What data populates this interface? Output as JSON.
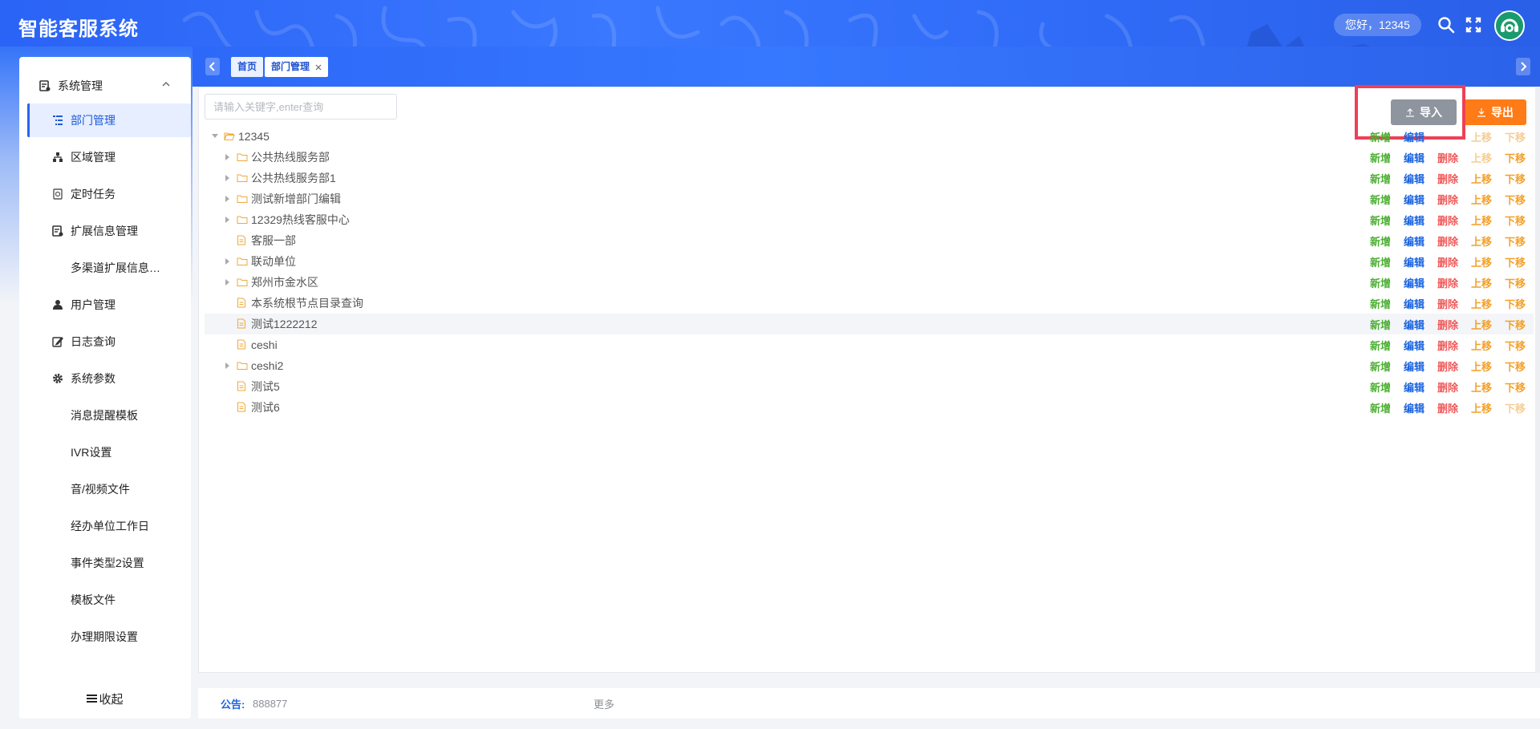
{
  "header": {
    "app_title": "智能客服系统",
    "greeting": "您好，12345",
    "icons": [
      "search-icon",
      "fullscreen-icon",
      "avatar-headset-icon"
    ]
  },
  "sidebar": {
    "group_label": "系统管理",
    "items": [
      {
        "label": "部门管理",
        "icon": "tree-list-icon",
        "active": true
      },
      {
        "label": "区域管理",
        "icon": "org-chart-icon"
      },
      {
        "label": "定时任务",
        "icon": "timer-icon"
      },
      {
        "label": "扩展信息管理",
        "icon": "document-icon"
      },
      {
        "label": "多渠道扩展信息…",
        "icon": ""
      },
      {
        "label": "用户管理",
        "icon": "user-icon"
      },
      {
        "label": "日志查询",
        "icon": "edit-log-icon"
      },
      {
        "label": "系统参数",
        "icon": "gear-icon"
      },
      {
        "label": "消息提醒模板",
        "icon": ""
      },
      {
        "label": "IVR设置",
        "icon": ""
      },
      {
        "label": "音/视频文件",
        "icon": ""
      },
      {
        "label": "经办单位工作日",
        "icon": ""
      },
      {
        "label": "事件类型2设置",
        "icon": ""
      },
      {
        "label": "模板文件",
        "icon": ""
      },
      {
        "label": "办理期限设置",
        "icon": ""
      }
    ],
    "collapse_label": "收起"
  },
  "tabs": {
    "home": "首页",
    "active": "部门管理"
  },
  "toolbar": {
    "search_placeholder": "请输入关键字,enter查询",
    "import_label": "导入",
    "export_label": "导出"
  },
  "ops_labels": {
    "add": "新增",
    "edit": "编辑",
    "delete": "删除",
    "up": "上移",
    "down": "下移"
  },
  "tree": [
    {
      "label": "12345",
      "level": 0,
      "type": "folder-open",
      "expandable": true,
      "ops": [
        "add",
        "edit",
        "up-disabled",
        "down-disabled"
      ]
    },
    {
      "label": "公共热线服务部",
      "level": 1,
      "type": "folder",
      "expandable": true,
      "ops": [
        "add",
        "edit",
        "delete",
        "up-disabled",
        "down"
      ]
    },
    {
      "label": "公共热线服务部1",
      "level": 1,
      "type": "folder",
      "expandable": true,
      "ops": [
        "add",
        "edit",
        "delete",
        "up",
        "down"
      ]
    },
    {
      "label": "测试新增部门编辑",
      "level": 1,
      "type": "folder",
      "expandable": true,
      "ops": [
        "add",
        "edit",
        "delete",
        "up",
        "down"
      ]
    },
    {
      "label": "12329热线客服中心",
      "level": 1,
      "type": "folder",
      "expandable": true,
      "ops": [
        "add",
        "edit",
        "delete",
        "up",
        "down"
      ]
    },
    {
      "label": "客服一部",
      "level": 1,
      "type": "file",
      "expandable": false,
      "ops": [
        "add",
        "edit",
        "delete",
        "up",
        "down"
      ]
    },
    {
      "label": "联动单位",
      "level": 1,
      "type": "folder",
      "expandable": true,
      "ops": [
        "add",
        "edit",
        "delete",
        "up",
        "down"
      ]
    },
    {
      "label": "郑州市金水区",
      "level": 1,
      "type": "folder",
      "expandable": true,
      "ops": [
        "add",
        "edit",
        "delete",
        "up",
        "down"
      ]
    },
    {
      "label": "本系统根节点目录查询",
      "level": 1,
      "type": "file",
      "expandable": false,
      "ops": [
        "add",
        "edit",
        "delete",
        "up",
        "down"
      ]
    },
    {
      "label": "测试1222212",
      "level": 1,
      "type": "file",
      "expandable": false,
      "highlighted": true,
      "ops": [
        "add",
        "edit",
        "delete",
        "up",
        "down"
      ]
    },
    {
      "label": "ceshi",
      "level": 1,
      "type": "file",
      "expandable": false,
      "ops": [
        "add",
        "edit",
        "delete",
        "up",
        "down"
      ]
    },
    {
      "label": "ceshi2",
      "level": 1,
      "type": "folder",
      "expandable": true,
      "ops": [
        "add",
        "edit",
        "delete",
        "up",
        "down"
      ]
    },
    {
      "label": "测试5",
      "level": 1,
      "type": "file",
      "expandable": false,
      "ops": [
        "add",
        "edit",
        "delete",
        "up",
        "down"
      ]
    },
    {
      "label": "测试6",
      "level": 1,
      "type": "file",
      "expandable": false,
      "ops": [
        "add",
        "edit",
        "delete",
        "up",
        "down-disabled"
      ]
    }
  ],
  "footer": {
    "notice_label": "公告:",
    "notice_text": "888877",
    "more_label": "更多"
  },
  "colors": {
    "header_blue": "#2a63f5",
    "add_green": "#4caf33",
    "edit_blue": "#1b64e0",
    "delete_red": "#f05a5a",
    "move_orange": "#f3a029",
    "export_orange": "#ff7b17",
    "import_gray": "#8e959e",
    "highlight_red": "#ee4057"
  }
}
